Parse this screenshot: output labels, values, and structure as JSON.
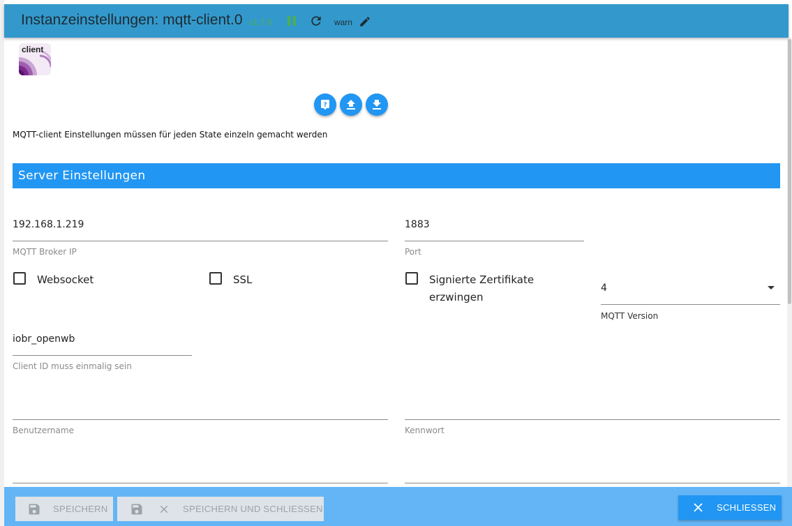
{
  "window": {
    "title": "Instanzeinstellungen: mqtt-client.0",
    "version": "v1.7.0",
    "loglevel": "warn",
    "status_color": "#4caf50",
    "title_bar_color": "#3399cc"
  },
  "logo": {
    "label": "client",
    "icon": "mqtt-client-logo"
  },
  "toolbar": {
    "help_icon": "help-icon",
    "upload_icon": "upload-icon",
    "download_icon": "download-icon"
  },
  "info_text": "MQTT-client Einstellungen müssen für jeden State einzeln gemacht werden",
  "section": {
    "title": "Server Einstellungen",
    "color": "#2196f3"
  },
  "fields": {
    "broker_ip": {
      "value": "192.168.1.219",
      "label": "MQTT Broker IP"
    },
    "port": {
      "value": "1883",
      "label": "Port"
    },
    "websocket": {
      "label": "Websocket",
      "checked": false
    },
    "ssl": {
      "label": "SSL",
      "checked": false
    },
    "signed_certs": {
      "label_line1": "Signierte Zertifikate",
      "label_line2": "erzwingen",
      "checked": false
    },
    "mqtt_version": {
      "value": "4",
      "label": "MQTT Version"
    },
    "client_id": {
      "value": "iobr_openwb",
      "label": "Client ID muss einmalig sein"
    },
    "username": {
      "value": "",
      "label": "Benutzername"
    },
    "password": {
      "value": "",
      "label": "Kennwort"
    }
  },
  "footer": {
    "save_label": "SPEICHERN",
    "save_close_label": "SPEICHERN UND SCHLIESSEN",
    "close_label": "SCHLIESSEN",
    "bar_color": "#64b5f6"
  }
}
